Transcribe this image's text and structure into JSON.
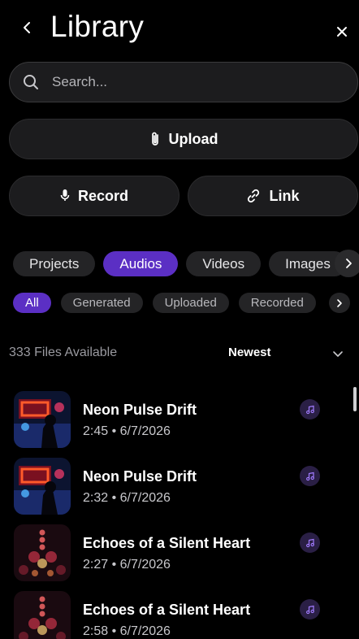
{
  "header": {
    "title": "Library",
    "back_icon": "chevron-left-icon",
    "close_icon": "close-icon"
  },
  "search": {
    "placeholder": "Search...",
    "value": ""
  },
  "actions": {
    "upload_label": "Upload",
    "record_label": "Record",
    "link_label": "Link"
  },
  "tabs": [
    {
      "label": "Projects",
      "active": false
    },
    {
      "label": "Audios",
      "active": true
    },
    {
      "label": "Videos",
      "active": false
    },
    {
      "label": "Images",
      "active": false
    }
  ],
  "filters": [
    {
      "label": "All",
      "active": true
    },
    {
      "label": "Generated",
      "active": false
    },
    {
      "label": "Uploaded",
      "active": false
    },
    {
      "label": "Recorded",
      "active": false
    }
  ],
  "summary": {
    "count_text": "333 Files Available",
    "sort_label": "Newest"
  },
  "items": [
    {
      "title": "Neon Pulse Drift",
      "meta": "2:45 • 6/7/2026",
      "thumb": "neon-concert",
      "type_icon": "music-note-icon"
    },
    {
      "title": "Neon Pulse Drift",
      "meta": "2:32 • 6/7/2026",
      "thumb": "neon-concert",
      "type_icon": "music-note-icon"
    },
    {
      "title": "Echoes of a Silent Heart",
      "meta": "2:27 • 6/7/2026",
      "thumb": "bokeh-lights",
      "type_icon": "music-note-icon"
    },
    {
      "title": "Echoes of a Silent Heart",
      "meta": "2:58 • 6/7/2026",
      "thumb": "bokeh-lights",
      "type_icon": "music-note-icon"
    }
  ],
  "colors": {
    "accent": "#5b2fc4",
    "background": "#000000",
    "surface": "#1c1c1e"
  }
}
